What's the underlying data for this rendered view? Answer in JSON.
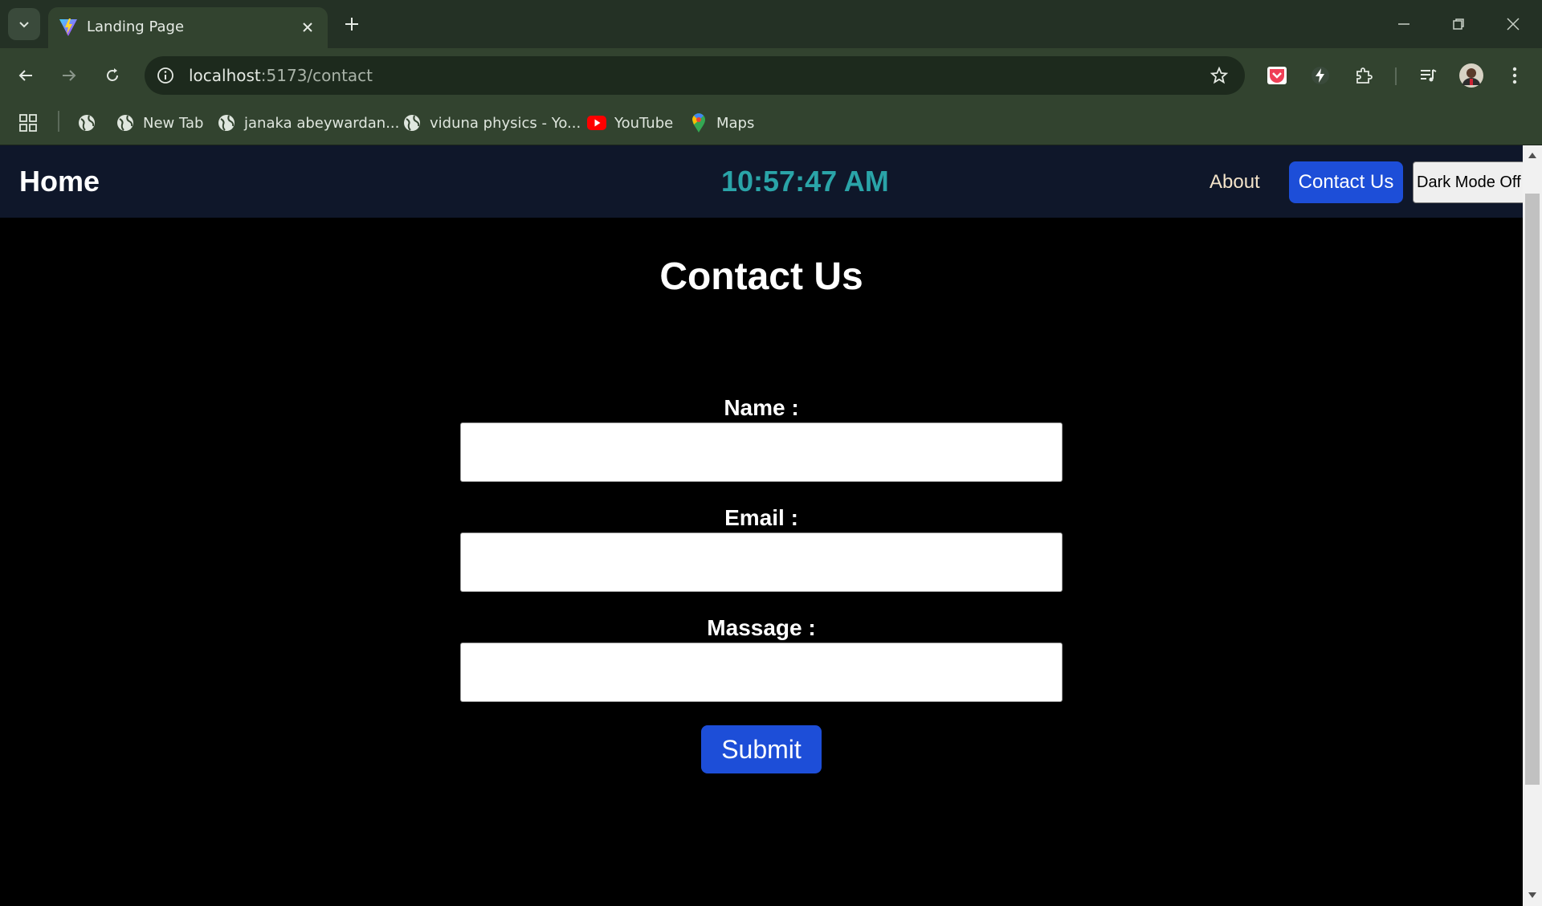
{
  "browser": {
    "tab_title": "Landing Page",
    "url_host": "localhost",
    "url_rest": ":5173/contact",
    "bookmarks": [
      {
        "label": ""
      },
      {
        "label": "New Tab"
      },
      {
        "label": "janaka abeywardan..."
      },
      {
        "label": "viduna physics - Yo..."
      },
      {
        "label": "YouTube"
      },
      {
        "label": "Maps"
      }
    ]
  },
  "navbar": {
    "home": "Home",
    "clock": "10:57:47 AM",
    "about": "About",
    "contact": "Contact Us",
    "dark_mode": "Dark Mode Off"
  },
  "form": {
    "title": "Contact Us",
    "name_label": "Name :",
    "email_label": "Email :",
    "message_label": "Massage :",
    "name_value": "",
    "email_value": "",
    "message_value": "",
    "submit": "Submit"
  },
  "colors": {
    "accent": "#1d4ed8",
    "clock": "#2aa4a8",
    "navbar_bg": "#0f172a",
    "page_bg": "#000000"
  }
}
